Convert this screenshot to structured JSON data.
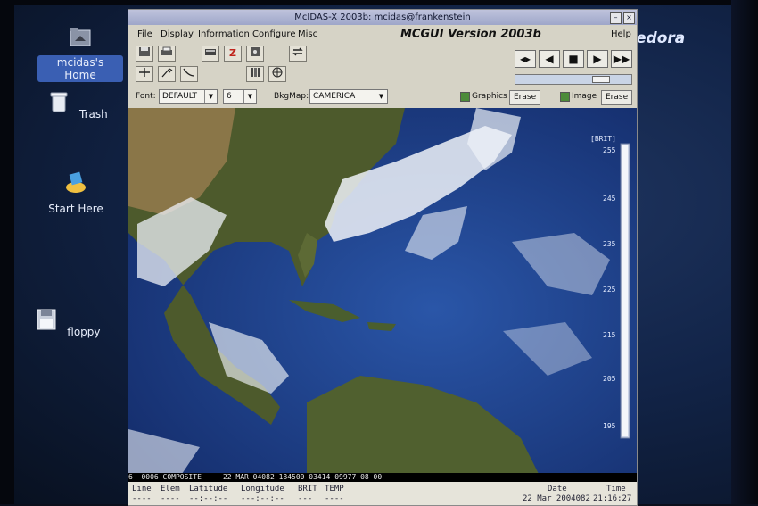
{
  "desktop": {
    "icons": [
      {
        "label": "mcidas's Home",
        "icon": "home-folder-icon",
        "selected": true
      },
      {
        "label": "Trash",
        "icon": "trash-icon",
        "selected": false
      },
      {
        "label": "Start Here",
        "icon": "start-here-icon",
        "selected": false
      },
      {
        "label": "floppy",
        "icon": "floppy-icon",
        "selected": false
      }
    ],
    "brand_text": "edora"
  },
  "window": {
    "title": "McIDAS-X 2003b: mcidas@frankenstein",
    "menus": [
      "File",
      "Display",
      "Information",
      "Configure",
      "Misc"
    ],
    "version_label": "MCGUI Version 2003b",
    "help_label": "Help"
  },
  "toolbar": {
    "icons": [
      "save-icon",
      "print-icon",
      "keyboard-icon",
      "zoom-icon",
      "disk-icon",
      "cycle-icon",
      "cursor-icon",
      "wind-barb-icon",
      "front-icon",
      "layers-icon",
      "globe-icon"
    ],
    "zoom_glyph": "Z",
    "loop_controls": [
      "loop-toggle-icon",
      "step-back-icon",
      "stop-icon",
      "play-icon",
      "fast-forward-icon"
    ]
  },
  "options": {
    "font_label": "Font:",
    "font_value": "DEFAULT",
    "size_value": "6",
    "bkgmap_label": "BkgMap:",
    "bkgmap_value": "CAMERICA",
    "graphics_label": "Graphics",
    "image_label": "Image",
    "erase_label": "Erase"
  },
  "colorbar": {
    "title": "BRIT",
    "units": "[BRIT]",
    "ticks": [
      "255",
      "245",
      "235",
      "225",
      "215",
      "205",
      "195"
    ]
  },
  "frame": {
    "label": "6  0006 COMPOSITE     22 MAR 04082 184500 03414 09977 08 00"
  },
  "status": {
    "columns": [
      "Line",
      "Elem",
      "Latitude",
      "Longitude",
      "BRIT",
      "TEMP"
    ],
    "values": [
      "----",
      "----",
      "--:--:--",
      "---:--:--",
      "---",
      "----"
    ],
    "date_label": "Date",
    "time_label": "Time",
    "date_value": "22 Mar 2004082",
    "time_value": "21:16:27"
  },
  "colors": {
    "ocean": "#1b3f8f",
    "land": "#4a5a2a",
    "cloud": "#eef2f8",
    "titlebar": "#a9b0d0"
  }
}
